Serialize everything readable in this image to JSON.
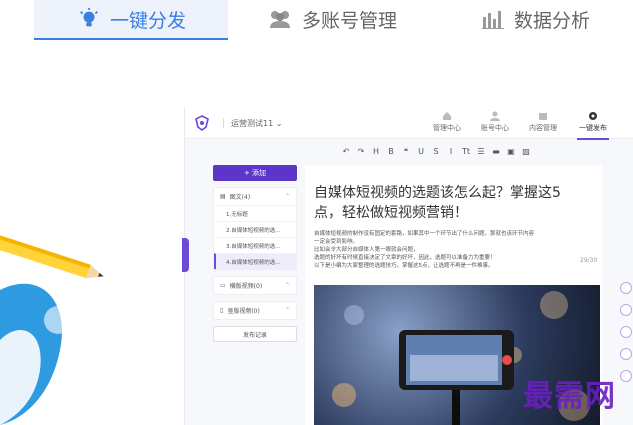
{
  "tabs": [
    {
      "label": "一键分发",
      "icon": "lightbulb-icon"
    },
    {
      "label": "多账号管理",
      "icon": "users-icon"
    },
    {
      "label": "数据分析",
      "icon": "bar-chart-icon"
    }
  ],
  "app": {
    "workspace": "运营测试11",
    "nav": [
      {
        "label": "管理中心",
        "icon": "home-icon"
      },
      {
        "label": "账号中心",
        "icon": "user-icon"
      },
      {
        "label": "内容管理",
        "icon": "folder-icon"
      },
      {
        "label": "一键发布",
        "icon": "send-icon"
      }
    ],
    "add_button": "+ 添加",
    "groups": [
      {
        "label": "图文(4)",
        "articles": [
          "1.无标题",
          "2.自媒体短视频的选...",
          "3.自媒体短视频的选...",
          "4.自媒体短视频的选..."
        ]
      },
      {
        "label": "横版视频(0)",
        "articles": []
      },
      {
        "label": "竖版视频(0)",
        "articles": []
      }
    ],
    "record_button": "发布记录",
    "toolbar": [
      "↶",
      "↷",
      "H",
      "B",
      "❝",
      "U",
      "S",
      "I",
      "Tt",
      "☰",
      "▬",
      "▣",
      "▨"
    ],
    "editor": {
      "title": "自媒体短视频的选题该怎么起？掌握这5点，轻松做短视频营销！",
      "count": "29/30",
      "body": [
        "自媒体短视频的制作没有固定的套路，如果其中一个环节出了什么问题，那就也该环节内容",
        "一定会受到影响。",
        "比如会令大部分自媒体人第一眼就会问题，",
        "选题的好坏有时候直接决定了文章的好坏，因此，选题可以准备力为重要！",
        "以下是小编为大家整理的选题技巧，掌握这5点，让选题不再是一件难事。"
      ]
    },
    "watermark": "最需网"
  },
  "colors": {
    "accent": "#3b7fe0",
    "purple": "#6d4bd6"
  }
}
